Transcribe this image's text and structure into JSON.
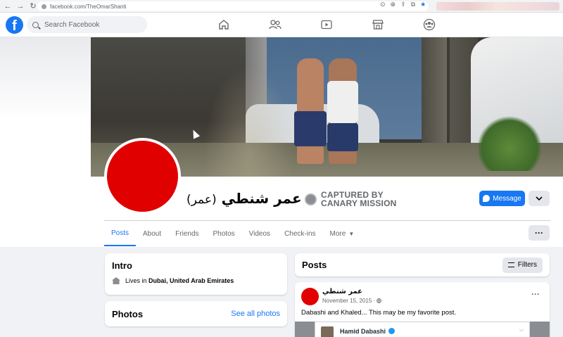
{
  "browser": {
    "url": "facebook.com/TheOmarShanti",
    "back_icon": "back-arrow-icon",
    "forward_icon": "forward-arrow-icon",
    "reload_icon": "reload-icon"
  },
  "header": {
    "logo_letter": "f",
    "search_placeholder": "Search Facebook",
    "nav_icons": [
      "home-icon",
      "friends-icon",
      "watch-icon",
      "marketplace-icon",
      "groups-icon"
    ]
  },
  "profile": {
    "name": "عمر شنطي",
    "alt_name": "(عمر)",
    "stamp_line1": "CAPTURED BY",
    "stamp_line2": "CANARY MISSION",
    "message_label": "Message",
    "more_icon": "chevron-down-icon",
    "avatar_color": "#e00000"
  },
  "tabs": [
    {
      "label": "Posts",
      "active": true
    },
    {
      "label": "About",
      "active": false
    },
    {
      "label": "Friends",
      "active": false
    },
    {
      "label": "Photos",
      "active": false
    },
    {
      "label": "Videos",
      "active": false
    },
    {
      "label": "Check-ins",
      "active": false
    },
    {
      "label": "More",
      "active": false
    }
  ],
  "tabs_more_caret": "▼",
  "options_dots": "···",
  "intro": {
    "title": "Intro",
    "lives_prefix": "Lives in ",
    "lives_place": "Dubai, United Arab Emirates"
  },
  "photos": {
    "title": "Photos",
    "see_all": "See all photos"
  },
  "posts_section": {
    "title": "Posts",
    "filters_label": "Filters"
  },
  "post": {
    "author": "عمر شنطي",
    "date": "November 15, 2015 · ",
    "text": "Dabashi and Khaled... This may be my favorite post.",
    "embed_name": "Hamid Dabashi"
  },
  "colors": {
    "brand": "#1877f2",
    "avatar": "#e00000",
    "background": "#f0f2f5"
  }
}
